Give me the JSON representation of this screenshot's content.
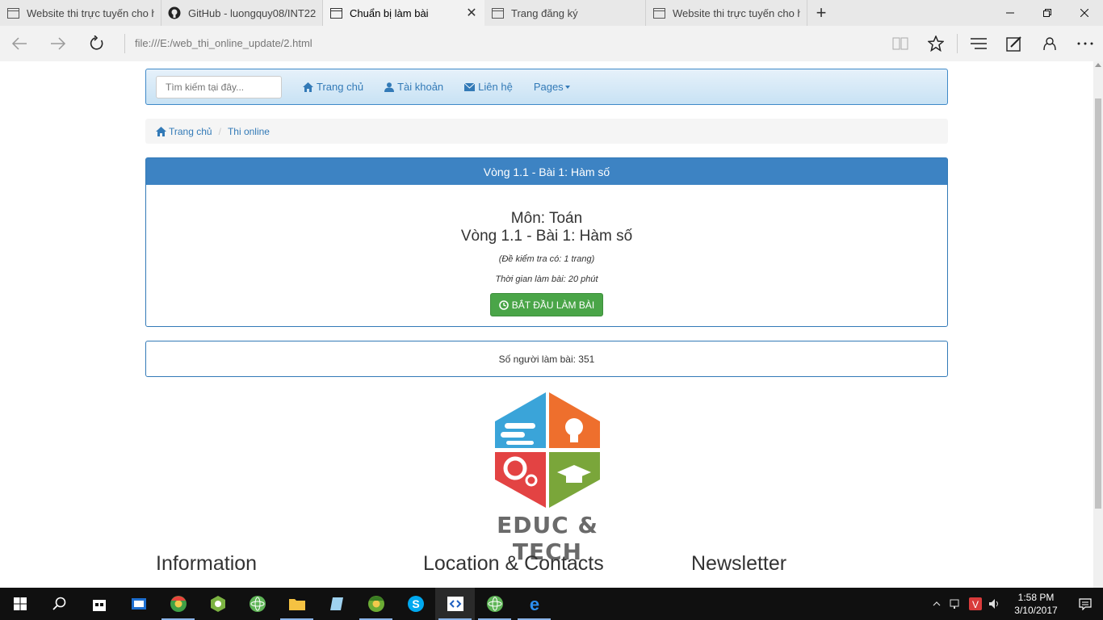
{
  "browser": {
    "tabs": [
      {
        "label": "Website thi trực tuyến cho h",
        "icon": "page-icon",
        "active": false
      },
      {
        "label": "GitHub - luongquy08/INT22",
        "icon": "github-icon",
        "active": false
      },
      {
        "label": "Chuẩn bị làm bài",
        "icon": "page-icon",
        "active": true,
        "close": "✕"
      },
      {
        "label": "Trang đăng ký",
        "icon": "page-icon",
        "active": false
      },
      {
        "label": "Website thi trực tuyến cho h",
        "icon": "page-icon",
        "active": false
      }
    ],
    "new_tab": "+",
    "window_controls": {
      "minimize": "—",
      "restore": "❐",
      "close": "✕"
    },
    "url": "file:///E:/web_thi_online_update/2.html",
    "address_icons": [
      "reading-view-icon",
      "favorite-star-icon",
      "hub-icon",
      "web-note-icon",
      "share-icon",
      "more-icon"
    ]
  },
  "navbar": {
    "search_placeholder": "Tìm kiếm tại đây...",
    "links": [
      {
        "label": "Trang chủ",
        "icon": "home-icon"
      },
      {
        "label": "Tài khoản",
        "icon": "user-icon"
      },
      {
        "label": "Liên hệ",
        "icon": "envelope-icon"
      },
      {
        "label": "Pages",
        "icon": "caret-down-icon"
      }
    ]
  },
  "breadcrumb": {
    "home": "Trang chủ",
    "separator": "/",
    "current": "Thi online"
  },
  "exam": {
    "heading": "Vòng 1.1 - Bài 1: Hàm số",
    "subject": "Môn: Toán",
    "lesson": "Vòng 1.1 - Bài 1: Hàm số",
    "note": "(Đề kiểm tra có: 1 trang)",
    "duration": "Thời gian làm bài: 20 phút",
    "start_button": "BẮT ĐẦU LÀM BÀI"
  },
  "participants": "Số người làm bài: 351",
  "logo": {
    "text": "EDUC & TECH"
  },
  "footer": {
    "columns": [
      "Information",
      "Location & Contacts",
      "Newsletter"
    ]
  },
  "taskbar": {
    "apps": [
      "start-icon",
      "search-icon",
      "store-icon",
      "task-view-icon",
      "chrome-icon",
      "android-studio-icon",
      "atom-icon",
      "file-explorer-icon",
      "notepad-icon",
      "chrome-canary-icon",
      "skype-icon",
      "visual-studio-code-icon",
      "atom-icon",
      "edge-icon"
    ],
    "time": "1:58 PM",
    "date": "3/10/2017"
  },
  "colors": {
    "link": "#337ab7",
    "panel_heading": "#3d83c3",
    "button_green": "#4aa548"
  }
}
